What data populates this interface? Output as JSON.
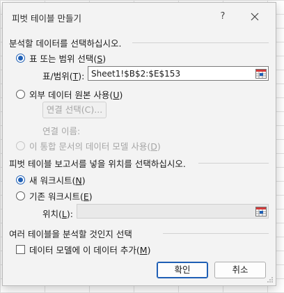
{
  "dialog": {
    "title": "피벗 테이블 만들기",
    "help_label": "?",
    "close_icon": "close-icon"
  },
  "section_data": {
    "heading": "분석할 데이터를 선택하십시오."
  },
  "option_range": {
    "label_prefix": "표 또는 범위 선택(",
    "label_key": "S",
    "label_suffix": ")",
    "selected": true
  },
  "range_field": {
    "label_prefix": "표/범위(",
    "label_key": "T",
    "label_suffix": "):",
    "value": "Sheet1!$B$2:$E$153",
    "icon": "range-select-icon"
  },
  "option_external": {
    "label_prefix": "외부 데이터 원본 사용(",
    "label_key": "U",
    "label_suffix": ")",
    "selected": false
  },
  "connection": {
    "button_label": "연결 선택(C)...",
    "name_label": "연결 이름:"
  },
  "option_model": {
    "label_prefix": "이 통합 문서의 데이터 모델 사용(",
    "label_key": "D",
    "label_suffix": ")",
    "selected": false,
    "disabled": true
  },
  "section_location": {
    "heading": "피벗 테이블 보고서를 넣을 위치를 선택하십시오."
  },
  "option_new_sheet": {
    "label_prefix": "새 워크시트(",
    "label_key": "N",
    "label_suffix": ")",
    "selected": true
  },
  "option_existing_sheet": {
    "label_prefix": "기존 워크시트(",
    "label_key": "E",
    "label_suffix": ")",
    "selected": false
  },
  "location_field": {
    "label_prefix": "위치(",
    "label_key": "L",
    "label_suffix": "):",
    "value": "",
    "icon": "range-select-icon"
  },
  "section_multi": {
    "heading": "여러 테이블을 분석할 것인지 선택"
  },
  "add_to_model": {
    "label_prefix": "데이터 모델에 이 데이터 추가(",
    "label_key": "M",
    "label_suffix": ")",
    "checked": false
  },
  "buttons": {
    "ok": "확인",
    "cancel": "취소"
  },
  "colors": {
    "accent": "#1f5fb5",
    "dialog_bg": "#f3f3f3",
    "disabled_text": "#a5a5a5"
  }
}
